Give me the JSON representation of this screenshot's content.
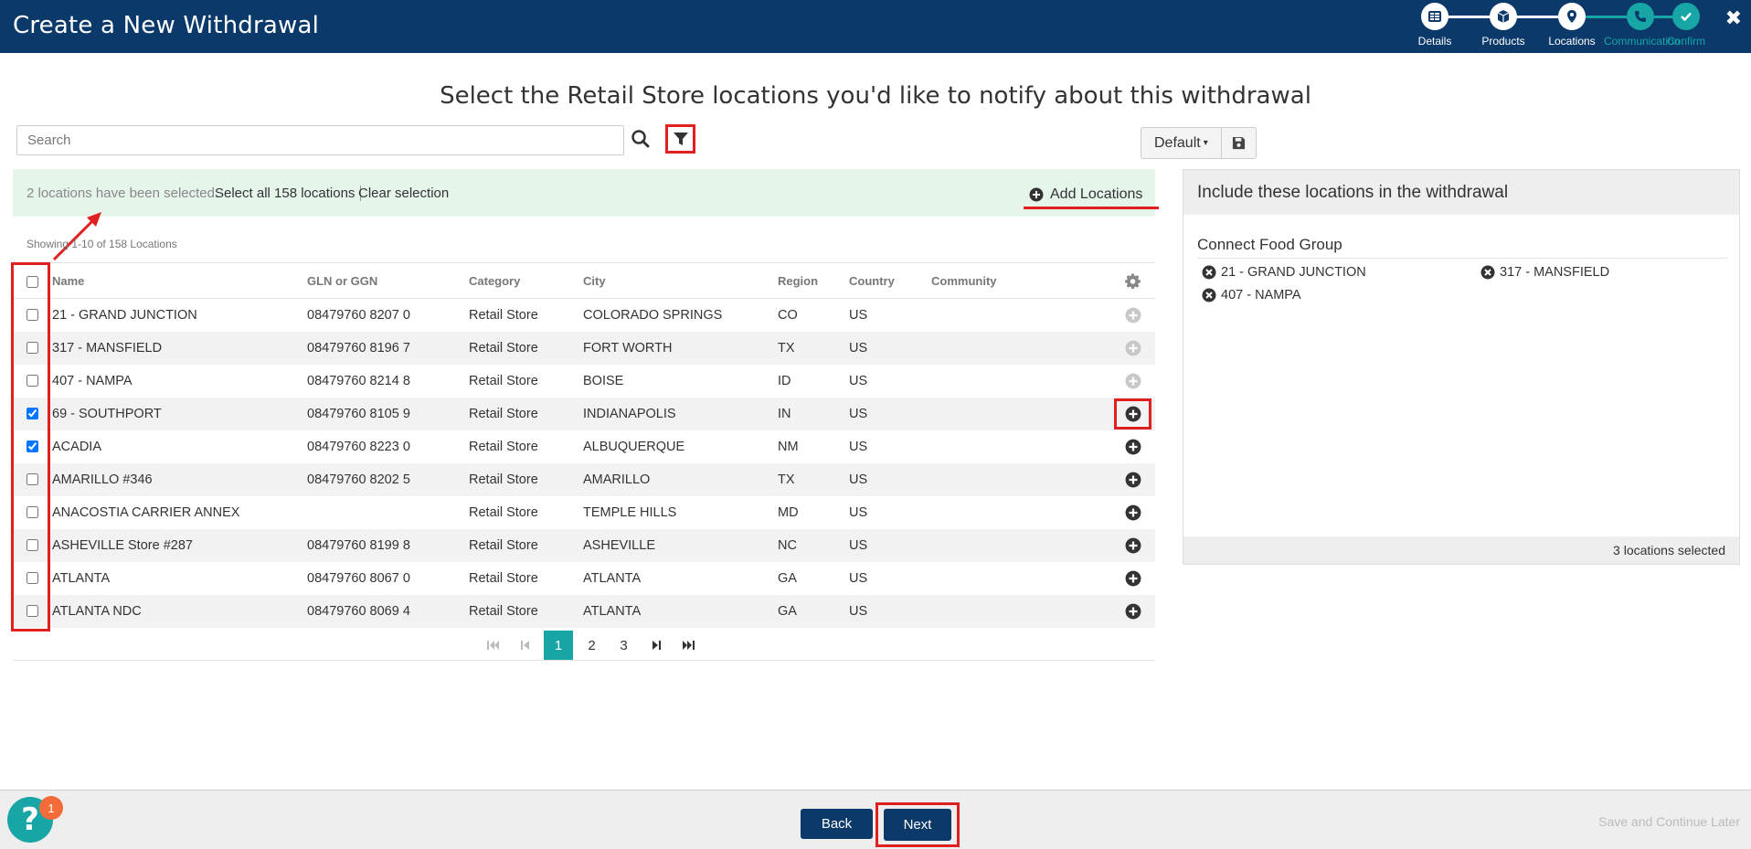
{
  "header": {
    "title": "Create a New Withdrawal",
    "steps": [
      {
        "label": "Details",
        "state": "done",
        "icon": "list-icon"
      },
      {
        "label": "Products",
        "state": "done",
        "icon": "box-icon"
      },
      {
        "label": "Locations",
        "state": "current",
        "icon": "map-pin-icon"
      },
      {
        "label": "Communication",
        "state": "upcoming",
        "icon": "phone-icon"
      },
      {
        "label": "Confirm",
        "state": "upcoming",
        "icon": "check-icon"
      }
    ],
    "close_label": "✖"
  },
  "page": {
    "heading": "Select the Retail Store locations you'd like to notify about this withdrawal"
  },
  "search": {
    "placeholder": "Search",
    "value": ""
  },
  "view": {
    "default_label": "Default",
    "caret": "▾"
  },
  "selection_bar": {
    "text": "2 locations have been selected.",
    "select_all": "Select all 158 locations",
    "clear": "Clear selection",
    "add_locations": "Add Locations"
  },
  "table": {
    "showing": "Showing 1-10 of 158 Locations",
    "columns": [
      "Name",
      "GLN or GGN",
      "Category",
      "City",
      "Region",
      "Country",
      "Community"
    ],
    "rows": [
      {
        "checked": false,
        "name": "21 - GRAND JUNCTION",
        "gln": "08479760 8207 0",
        "category": "Retail Store",
        "city": "COLORADO SPRINGS",
        "region": "CO",
        "country": "US",
        "community": "",
        "added": true
      },
      {
        "checked": false,
        "name": "317 - MANSFIELD",
        "gln": "08479760 8196 7",
        "category": "Retail Store",
        "city": "FORT WORTH",
        "region": "TX",
        "country": "US",
        "community": "",
        "added": true
      },
      {
        "checked": false,
        "name": "407 - NAMPA",
        "gln": "08479760 8214 8",
        "category": "Retail Store",
        "city": "BOISE",
        "region": "ID",
        "country": "US",
        "community": "",
        "added": true
      },
      {
        "checked": true,
        "name": "69 - SOUTHPORT",
        "gln": "08479760 8105 9",
        "category": "Retail Store",
        "city": "INDIANAPOLIS",
        "region": "IN",
        "country": "US",
        "community": "",
        "added": false,
        "highlight": true
      },
      {
        "checked": true,
        "name": "ACADIA",
        "gln": "08479760 8223 0",
        "category": "Retail Store",
        "city": "ALBUQUERQUE",
        "region": "NM",
        "country": "US",
        "community": "",
        "added": false
      },
      {
        "checked": false,
        "name": "AMARILLO #346",
        "gln": "08479760 8202 5",
        "category": "Retail Store",
        "city": "AMARILLO",
        "region": "TX",
        "country": "US",
        "community": "",
        "added": false
      },
      {
        "checked": false,
        "name": "ANACOSTIA CARRIER ANNEX",
        "gln": "",
        "category": "Retail Store",
        "city": "TEMPLE HILLS",
        "region": "MD",
        "country": "US",
        "community": "",
        "added": false
      },
      {
        "checked": false,
        "name": "ASHEVILLE Store #287",
        "gln": "08479760 8199 8",
        "category": "Retail Store",
        "city": "ASHEVILLE",
        "region": "NC",
        "country": "US",
        "community": "",
        "added": false
      },
      {
        "checked": false,
        "name": "ATLANTA",
        "gln": "08479760 8067 0",
        "category": "Retail Store",
        "city": "ATLANTA",
        "region": "GA",
        "country": "US",
        "community": "",
        "added": false
      },
      {
        "checked": false,
        "name": "ATLANTA NDC",
        "gln": "08479760 8069 4",
        "category": "Retail Store",
        "city": "ATLANTA",
        "region": "GA",
        "country": "US",
        "community": "",
        "added": false
      }
    ]
  },
  "pagination": {
    "pages": [
      "1",
      "2",
      "3"
    ],
    "current": "1"
  },
  "right_panel": {
    "title": "Include these locations in the withdrawal",
    "group_name": "Connect Food Group",
    "items": [
      "21 - GRAND JUNCTION",
      "317 - MANSFIELD",
      "407 - NAMPA"
    ],
    "footer": "3 locations selected"
  },
  "footer": {
    "back": "Back",
    "next": "Next",
    "save_later": "Save and Continue Later",
    "help": "?",
    "help_badge": "1"
  },
  "colors": {
    "header_bg": "#0b3a6a",
    "accent_teal": "#17a5a5",
    "annotation_red": "#e02020",
    "selection_bg": "#e5f5ea"
  }
}
